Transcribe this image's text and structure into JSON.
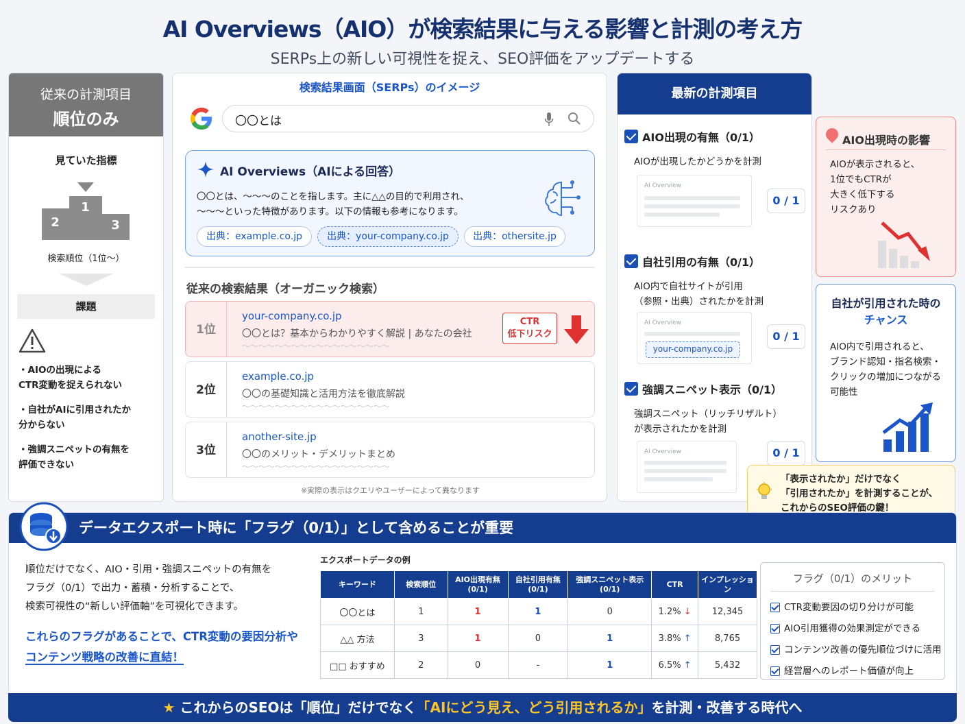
{
  "header": {
    "title": "AI Overviews（AIO）が検索結果に与える影響と計測の考え方",
    "subtitle": "SERPs上の新しい可視性を捉え、SEO評価をアップデートする"
  },
  "left": {
    "head1": "従来の計測項目",
    "head2": "順位のみ",
    "watched": "見ていた指標",
    "podium": [
      "1",
      "2",
      "3"
    ],
    "caption": "検索順位（1位〜）",
    "issue": "課題",
    "issues": [
      "・AIOの出現による\nCTR変動を捉えられない",
      "・自社がAIに引用されたか\n分からない",
      "・強調スニペットの有無を\n評価できない"
    ]
  },
  "serp": {
    "title": "検索結果画面（SERPs）のイメージ",
    "query": "〇〇とは",
    "aio_title": "AI Overviews（AIによる回答）",
    "aio_text": "〇〇とは、〜〜〜のことを指します。主に△△の目的で利用され、\n〜〜〜といった特徴があります。以下の情報も参考になります。",
    "sources": [
      "出典：example.co.jp",
      "出典：your-company.co.jp",
      "出典：othersite.jp"
    ],
    "organic_title": "従来の検索結果（オーガニック検索）",
    "results": [
      {
        "rank": "1位",
        "url": "your-company.co.jp",
        "desc": "〇〇とは？基本からわかりやすく解説 | あなたの会社",
        "tilde": "〜〜〜〜〜〜〜〜〜〜〜〜〜〜〜〜〜〜"
      },
      {
        "rank": "2位",
        "url": "example.co.jp",
        "desc": "〇〇の基礎知識と活用方法を徹底解説",
        "tilde": "〜〜〜〜〜〜〜〜〜〜〜〜〜〜〜〜〜〜"
      },
      {
        "rank": "3位",
        "url": "another-site.jp",
        "desc": "〇〇のメリット・デメリットまとめ",
        "tilde": "〜〜〜〜〜〜〜〜〜〜〜〜〜〜〜〜〜〜"
      }
    ],
    "ctr1": "CTR",
    "ctr2": "低下リスク",
    "note": "※実際の表示はクエリやユーザーによって異なります"
  },
  "metrics": {
    "head": "最新の計測項目",
    "items": [
      {
        "label": "AIO出現の有無（0/1）",
        "desc": "AIOが出現したかどうかを計測",
        "value": "0 / 1"
      },
      {
        "label": "自社引用の有無（0/1）",
        "desc": "AIO内で自社サイトが引用\n（参照・出典）されたかを計測",
        "value": "0 / 1"
      },
      {
        "label": "強調スニペット表示（0/1）",
        "desc": "強調スニペット（リッチリザルト）\nが表示されたかを計測",
        "value": "0 / 1"
      }
    ],
    "thumb_label": "AI Overview",
    "thumb_cite": "your-company.co.jp"
  },
  "risk": {
    "title": "AIO出現時の影響",
    "body": "AIOが表示されると、\n1位でもCTRが\n大きく低下する\nリスクあり"
  },
  "chance": {
    "title1": "自社が引用された時の",
    "title2": "チャンス",
    "body": "AIO内で引用されると、\nブランド認知・指名検索・\nクリックの増加につながる\n可能性"
  },
  "tip": {
    "text": "「表示されたか」だけでなく\n「引用されたか」を計測することが、\nこれからのSEO評価の鍵！"
  },
  "bottom": {
    "head": "データエクスポート時に「フラグ（0/1）」として含めることが重要",
    "p1": "順位だけでなく、AIO・引用・強調スニペットの有無を\nフラグ（0/1）で出力・蓄積・分析することで、\n検索可視性の“新しい評価軸”を可視化できます。",
    "p2a": "これらのフラグがあることで、CTR変動の要因分析や",
    "p2b": "コンテンツ戦略の改善に直結！",
    "ex_title": "エクスポートデータの例",
    "columns": [
      "キーワード",
      "検索順位",
      "AIO出現有無\n(0/1)",
      "自社引用有無\n(0/1)",
      "強調スニペット表示\n(0/1)",
      "CTR",
      "インプレッション"
    ],
    "rows": [
      [
        "〇〇とは",
        "1",
        "1",
        "1",
        "0",
        "1.2%",
        "12,345"
      ],
      [
        "△△ 方法",
        "3",
        "1",
        "0",
        "1",
        "3.8%",
        "8,765"
      ],
      [
        "□□ おすすめ",
        "2",
        "0",
        "-",
        "1",
        "6.5%",
        "5,432"
      ]
    ],
    "merit_title": "フラグ（0/1）のメリット",
    "merits": [
      "CTR変動要因の切り分けが可能",
      "AIO引用獲得の効果測定ができる",
      "コンテンツ改善の優先順位づけに活用",
      "経営層へのレポート価値が向上"
    ]
  },
  "footer": {
    "star": "★",
    "a": "これからのSEOは「順位」だけでなく",
    "b": "「AIにどう見え、どう引用されるか」",
    "c": "を計測・改善する時代へ"
  }
}
